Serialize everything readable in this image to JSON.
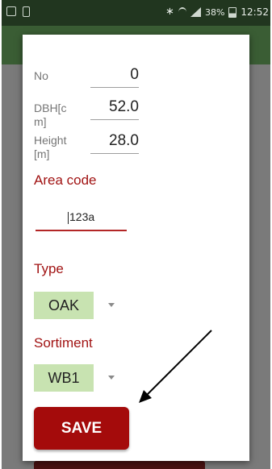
{
  "status_bar": {
    "battery_percent": "38%",
    "time": "12:52"
  },
  "dialog": {
    "fields": [
      {
        "label": "No",
        "value": "0"
      },
      {
        "label": "DBH[cm]",
        "value": "52.0"
      },
      {
        "label": "Height[m]",
        "value": "28.0"
      }
    ],
    "area_code": {
      "title": "Area code",
      "value": "123a"
    },
    "type": {
      "title": "Type",
      "selected": "OAK"
    },
    "sortiment": {
      "title": "Sortiment",
      "selected": "WB1"
    },
    "save_label": "SAVE"
  },
  "colors": {
    "accent_red": "#a11313",
    "button_red": "#a40b0b",
    "spinner_green": "#c8e3b1",
    "status_bar": "#21361f",
    "app_bar": "#3a5d34"
  }
}
